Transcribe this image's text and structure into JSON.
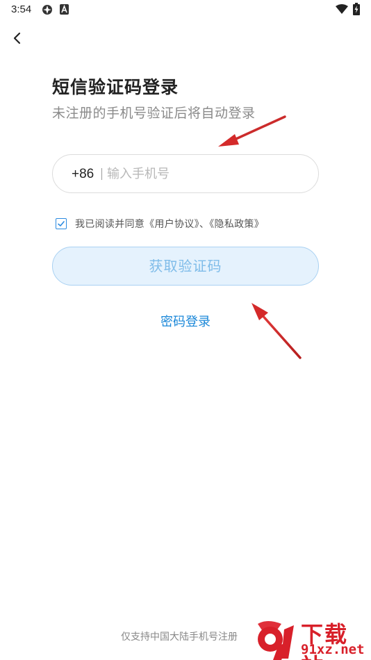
{
  "status_bar": {
    "time": "3:54",
    "icons": [
      "sync-icon",
      "notification-a-icon",
      "wifi-icon",
      "battery-charging-icon"
    ]
  },
  "nav": {
    "back_icon": "chevron-left-icon"
  },
  "header": {
    "title": "短信验证码登录",
    "subtitle": "未注册的手机号验证后将自动登录"
  },
  "phone": {
    "country_code": "+86",
    "value": "",
    "placeholder": "输入手机号"
  },
  "agreement": {
    "checked": true,
    "prefix": "我已阅读并同意",
    "user_agreement": "《用户协议》",
    "separator": "、",
    "privacy_policy": "《隐私政策》"
  },
  "actions": {
    "get_code_label": "获取验证码",
    "password_login_label": "密码登录"
  },
  "footer": {
    "note": "仅支持中国大陆手机号注册"
  },
  "watermark": {
    "title": "下载站",
    "domain": "91xz.net"
  },
  "colors": {
    "accent": "#1a87d8",
    "button_bg": "#e5f2fd",
    "button_text": "#7fbce9",
    "annotation_arrow": "#d42a2a",
    "watermark": "#d8202a"
  }
}
